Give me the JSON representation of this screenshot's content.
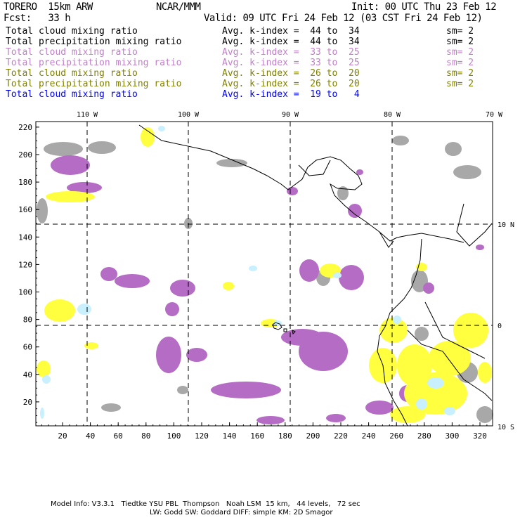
{
  "header": {
    "model": "TORERO  15km ARW",
    "org": "NCAR/MMM",
    "init": "Init: 00 UTC Thu 23 Feb 12",
    "fcst": "Fcst:   33 h",
    "valid": "Valid: 09 UTC Fri 24 Feb 12 (03 CST Fri 24 Feb 12)"
  },
  "legend": [
    {
      "field": "Total cloud mixing ratio",
      "range": "Avg. k-index =  44 to  34",
      "sm": "sm= 2",
      "color": "#000000"
    },
    {
      "field": "Total precipitation mixing ratio",
      "range": "Avg. k-index =  44 to  34",
      "sm": "sm= 2",
      "color": "#000000"
    },
    {
      "field": "Total cloud mixing ratio",
      "range": "Avg. k-index =  33 to  25",
      "sm": "sm= 2",
      "color": "#c080c8"
    },
    {
      "field": "Total precipitation mixing ratio",
      "range": "Avg. k-index =  33 to  25",
      "sm": "sm= 2",
      "color": "#c080c8"
    },
    {
      "field": "Total cloud mixing ratio",
      "range": "Avg. k-index =  26 to  20",
      "sm": "sm= 2",
      "color": "#808000"
    },
    {
      "field": "Total precipitation mixing ratio",
      "range": "Avg. k-index =  26 to  20",
      "sm": "sm= 2",
      "color": "#808000"
    },
    {
      "field": "Total cloud mixing ratio",
      "range": "Avg. k-index =  19 to   4",
      "sm": "",
      "color": "#0000ff"
    }
  ],
  "map": {
    "top_labels": [
      "110 W",
      "100 W",
      "90 W",
      "80 W",
      "70 W"
    ],
    "right_labels": [
      "10 N",
      "0",
      "10 S"
    ],
    "x_ticks": [
      "20",
      "40",
      "60",
      "80",
      "100",
      "120",
      "140",
      "160",
      "180",
      "200",
      "220",
      "240",
      "260",
      "280",
      "300",
      "320"
    ],
    "y_ticks": [
      "20",
      "40",
      "60",
      "80",
      "100",
      "120",
      "140",
      "160",
      "180",
      "200",
      "220"
    ],
    "colors": {
      "gray": "#a8a8a8",
      "purple": "#b46cc4",
      "yellow": "#ffff40",
      "lightblue": "#c8f0ff"
    }
  },
  "footer": {
    "line1": "Model Info: V3.3.1   Tiedtke YSU PBL  Thompson   Noah LSM  15 km,   44 levels,   72 sec",
    "line2": "LW: Godd SW: Goddard DIFF: simple KM: 2D Smagor"
  }
}
